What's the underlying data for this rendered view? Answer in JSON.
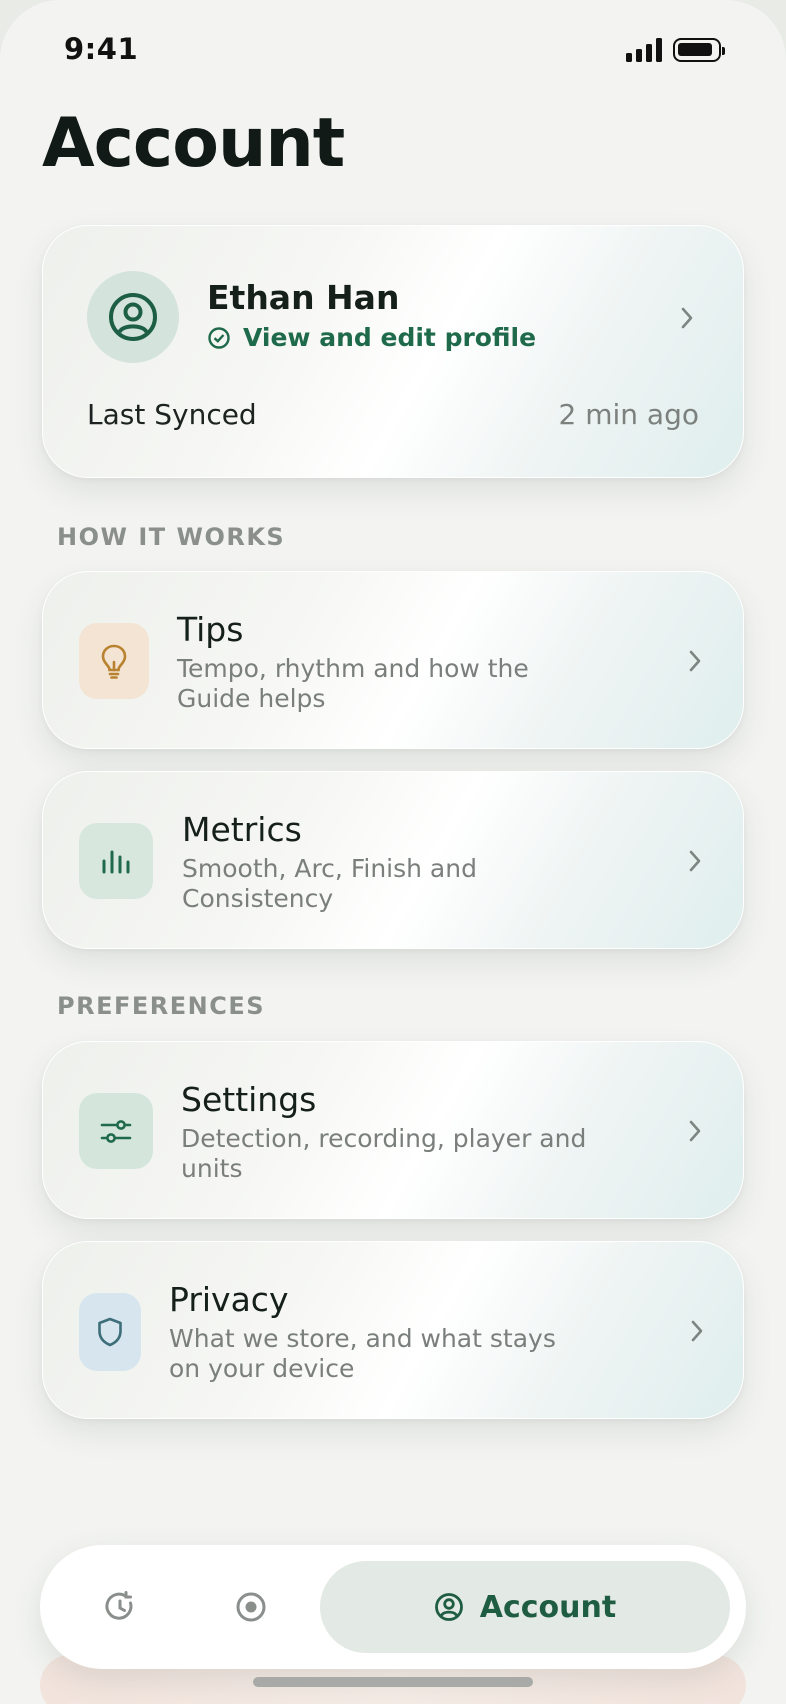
{
  "status_bar": {
    "time": "9:41"
  },
  "page": {
    "title": "Account"
  },
  "profile": {
    "name": "Ethan Han",
    "subtitle": "View and edit profile",
    "sync_label": "Last Synced",
    "sync_value": "2 min ago",
    "avatar_icon": "user-circle-icon",
    "verified_icon": "check-circle-icon"
  },
  "sections": {
    "how_it_works": {
      "label": "HOW IT WORKS",
      "items": [
        {
          "title": "Tips",
          "description": "Tempo, rhythm and how the Guide helps",
          "icon": "lightbulb-icon"
        },
        {
          "title": "Metrics",
          "description": "Smooth, Arc, Finish and Consistency",
          "icon": "bar-chart-icon"
        }
      ]
    },
    "preferences": {
      "label": "PREFERENCES",
      "items": [
        {
          "title": "Settings",
          "description": "Detection, recording, player and units",
          "icon": "sliders-icon"
        },
        {
          "title": "Privacy",
          "description": "What we store, and what stays on your device",
          "icon": "shield-icon"
        }
      ]
    }
  },
  "tab_bar": {
    "tabs": [
      {
        "icon": "history-icon"
      },
      {
        "icon": "record-icon"
      },
      {
        "icon": "user-circle-icon",
        "label": "Account",
        "active": true
      }
    ]
  },
  "colors": {
    "accent": "#1f6a4a",
    "background": "#f3f4f1",
    "tips_icon_bg": "#f3e4d3",
    "tips_icon": "#b98230",
    "metrics_icon_bg": "#d7e7de",
    "settings_icon_bg": "#d4e6dc",
    "privacy_icon_bg": "#d6e5ee",
    "privacy_icon": "#3d6e7a"
  }
}
